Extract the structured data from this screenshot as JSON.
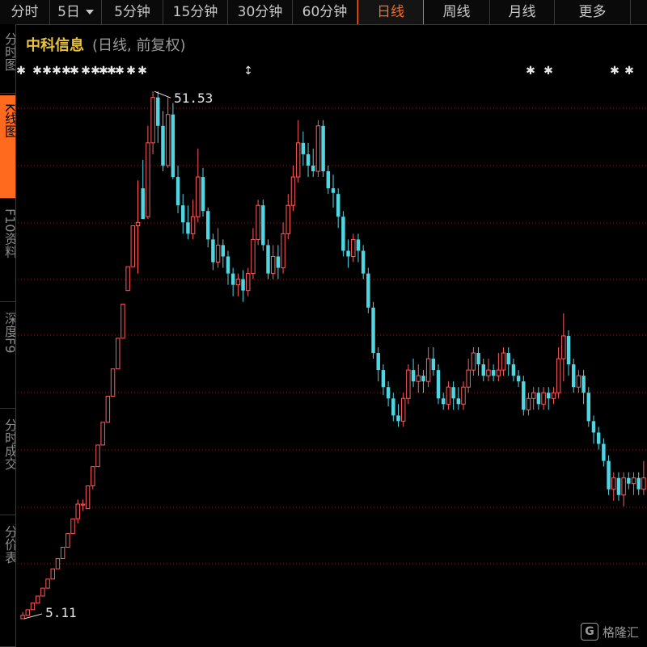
{
  "tabs": [
    {
      "label": "分时",
      "active": false
    },
    {
      "label": "5日",
      "active": false,
      "dropdown": true
    },
    {
      "label": "5分钟",
      "active": false
    },
    {
      "label": "15分钟",
      "active": false
    },
    {
      "label": "30分钟",
      "active": false
    },
    {
      "label": "60分钟",
      "active": false
    },
    {
      "label": "日线",
      "active": true
    },
    {
      "label": "周线",
      "active": false
    },
    {
      "label": "月线",
      "active": false
    },
    {
      "label": "更多",
      "active": false
    }
  ],
  "sidebar": [
    {
      "label": "分时图",
      "active": false
    },
    {
      "label": "K线图",
      "active": true
    },
    {
      "label": "F10资料",
      "active": false
    },
    {
      "label": "深度F9",
      "active": false
    },
    {
      "label": "分时成交",
      "active": false
    },
    {
      "label": "分价表",
      "active": false
    }
  ],
  "chart_title": {
    "name": "中科信息",
    "period": "(日线, 前复权)"
  },
  "watermark": {
    "logo": "G",
    "text": "格隆汇"
  },
  "colors": {
    "up": "#ff5c5c",
    "down": "#4fd6e3",
    "title": "#e8c23a",
    "active": "#ff6a1e",
    "grid": "#8a1e1e"
  },
  "chart_data": {
    "type": "candlestick",
    "price_range": [
      3.4,
      54.6
    ],
    "high_label": "51.53",
    "low_label": "5.11",
    "markers": [
      "✱",
      "✱",
      "✱",
      "✱",
      "✱",
      "✱",
      "✱",
      "✱",
      "✱",
      "✱",
      "✱",
      "✱",
      "✱",
      "↕",
      "✱",
      "✱",
      "✱",
      "✱"
    ],
    "candles": [
      [
        5.11,
        5.4,
        5.11,
        5.7
      ],
      [
        5.4,
        5.9,
        5.4,
        5.9
      ],
      [
        5.9,
        6.5,
        5.9,
        6.5
      ],
      [
        6.5,
        7.1,
        6.5,
        7.1
      ],
      [
        7.1,
        7.8,
        7.1,
        7.8
      ],
      [
        7.8,
        8.6,
        7.8,
        8.6
      ],
      [
        8.6,
        9.5,
        8.6,
        9.5
      ],
      [
        9.5,
        10.4,
        9.5,
        10.4
      ],
      [
        10.4,
        11.4,
        10.4,
        11.4
      ],
      [
        11.4,
        12.6,
        11.4,
        12.6
      ],
      [
        12.6,
        13.9,
        12.6,
        13.9
      ],
      [
        13.9,
        15.2,
        13.5,
        15.6
      ],
      [
        15.2,
        15.2,
        14.6,
        15.6
      ],
      [
        14.8,
        16.8,
        14.8,
        16.8
      ],
      [
        16.8,
        18.5,
        16.5,
        18.5
      ],
      [
        18.5,
        20.4,
        18.5,
        20.4
      ],
      [
        20.4,
        22.4,
        20.4,
        22.4
      ],
      [
        22.4,
        24.7,
        22.4,
        24.7
      ],
      [
        24.7,
        27.1,
        24.7,
        27.1
      ],
      [
        27.1,
        29.8,
        27.1,
        29.8
      ],
      [
        29.8,
        32.8,
        29.8,
        32.8
      ],
      [
        34.0,
        36.1,
        34.0,
        36.1
      ],
      [
        36.1,
        39.7,
        36.1,
        39.7
      ],
      [
        39.7,
        40.0,
        35.5,
        43.7
      ],
      [
        43.0,
        40.3,
        40.3,
        45.5
      ],
      [
        40.5,
        47.0,
        40.3,
        48.5
      ],
      [
        47.0,
        51.0,
        46.0,
        51.53
      ],
      [
        51.0,
        48.5,
        47.0,
        51.53
      ],
      [
        48.5,
        45.0,
        44.5,
        49.8
      ],
      [
        45.0,
        49.5,
        44.8,
        51.0
      ],
      [
        49.5,
        44.0,
        43.8,
        50.5
      ],
      [
        44.0,
        41.5,
        40.8,
        45.0
      ],
      [
        41.5,
        40.0,
        39.0,
        42.5
      ],
      [
        40.0,
        39.0,
        38.5,
        41.5
      ],
      [
        39.0,
        40.5,
        38.5,
        42.0
      ],
      [
        40.5,
        44.0,
        40.0,
        46.5
      ],
      [
        44.0,
        41.0,
        40.5,
        44.8
      ],
      [
        41.0,
        38.5,
        37.8,
        41.3
      ],
      [
        38.5,
        36.5,
        35.8,
        39.0
      ],
      [
        36.5,
        38.0,
        36.0,
        39.5
      ],
      [
        38.0,
        37.0,
        36.0,
        38.5
      ],
      [
        37.0,
        35.5,
        34.5,
        37.5
      ],
      [
        35.5,
        34.5,
        33.5,
        36.0
      ],
      [
        34.5,
        35.0,
        33.5,
        35.5
      ],
      [
        35.0,
        34.0,
        33.0,
        35.8
      ],
      [
        34.0,
        35.5,
        33.5,
        36.0
      ],
      [
        35.5,
        38.5,
        35.0,
        39.5
      ],
      [
        38.5,
        41.5,
        38.0,
        42.0
      ],
      [
        41.5,
        38.0,
        37.5,
        42.0
      ],
      [
        38.0,
        35.5,
        35.0,
        38.5
      ],
      [
        35.5,
        37.0,
        35.0,
        38.0
      ],
      [
        37.0,
        36.0,
        35.0,
        38.0
      ],
      [
        36.0,
        39.0,
        35.5,
        40.0
      ],
      [
        39.0,
        41.5,
        38.5,
        42.5
      ],
      [
        41.5,
        44.0,
        41.0,
        45.0
      ],
      [
        44.0,
        47.0,
        43.5,
        49.0
      ],
      [
        47.0,
        46.0,
        45.0,
        48.0
      ],
      [
        46.0,
        45.0,
        44.0,
        47.0
      ],
      [
        45.0,
        44.5,
        44.0,
        46.5
      ],
      [
        44.5,
        48.5,
        44.0,
        49.0
      ],
      [
        48.5,
        44.5,
        44.0,
        49.0
      ],
      [
        44.5,
        43.0,
        42.5,
        45.0
      ],
      [
        43.0,
        42.6,
        41.3,
        44.2
      ],
      [
        42.5,
        40.5,
        39.5,
        43.0
      ],
      [
        40.5,
        37.5,
        37.0,
        41.0
      ],
      [
        37.5,
        37.0,
        36.0,
        38.5
      ],
      [
        37.0,
        38.5,
        36.5,
        39.0
      ],
      [
        38.5,
        37.5,
        36.5,
        39.0
      ],
      [
        37.5,
        35.5,
        35.0,
        38.0
      ],
      [
        35.5,
        32.5,
        32.0,
        36.0
      ],
      [
        32.5,
        28.5,
        28.0,
        33.0
      ],
      [
        28.5,
        27.0,
        26.0,
        29.0
      ],
      [
        27.0,
        25.5,
        24.8,
        27.5
      ],
      [
        25.5,
        24.5,
        23.8,
        26.0
      ],
      [
        24.5,
        23.0,
        22.5,
        25.0
      ],
      [
        23.0,
        22.5,
        22.0,
        24.0
      ],
      [
        22.5,
        24.5,
        22.0,
        25.0
      ],
      [
        24.5,
        27.0,
        24.0,
        27.5
      ],
      [
        27.0,
        26.0,
        25.5,
        28.0
      ],
      [
        26.0,
        26.5,
        25.0,
        27.5
      ],
      [
        26.5,
        26.0,
        25.0,
        27.0
      ],
      [
        26.0,
        28.0,
        25.5,
        29.0
      ],
      [
        28.0,
        27.0,
        26.5,
        29.0
      ],
      [
        27.0,
        24.5,
        24.0,
        27.5
      ],
      [
        24.5,
        24.0,
        23.5,
        25.0
      ],
      [
        24.0,
        25.5,
        23.5,
        26.0
      ],
      [
        25.5,
        24.5,
        23.5,
        26.0
      ],
      [
        24.5,
        24.0,
        23.5,
        25.5
      ],
      [
        24.0,
        25.5,
        23.5,
        26.0
      ],
      [
        25.5,
        27.0,
        25.0,
        28.0
      ],
      [
        27.0,
        28.5,
        26.5,
        29.0
      ],
      [
        28.5,
        27.5,
        26.5,
        29.0
      ],
      [
        27.5,
        26.5,
        26.0,
        28.0
      ],
      [
        26.5,
        27.0,
        26.0,
        28.0
      ],
      [
        27.0,
        26.5,
        26.0,
        27.5
      ],
      [
        26.5,
        27.0,
        26.0,
        28.5
      ],
      [
        27.0,
        28.5,
        26.5,
        29.0
      ],
      [
        28.5,
        27.5,
        26.5,
        29.0
      ],
      [
        27.5,
        26.5,
        26.0,
        28.0
      ],
      [
        26.5,
        26.0,
        25.5,
        27.0
      ],
      [
        26.0,
        23.5,
        23.0,
        26.5
      ],
      [
        23.5,
        24.5,
        23.0,
        25.0
      ],
      [
        24.5,
        25.0,
        23.5,
        25.5
      ],
      [
        25.0,
        24.0,
        23.5,
        25.5
      ],
      [
        24.0,
        25.0,
        23.5,
        25.5
      ],
      [
        25.0,
        24.5,
        23.5,
        25.5
      ],
      [
        24.5,
        25.0,
        24.0,
        25.5
      ],
      [
        25.0,
        28.0,
        24.5,
        29.0
      ],
      [
        28.0,
        30.0,
        26.0,
        32.0
      ],
      [
        30.0,
        27.5,
        26.5,
        30.5
      ],
      [
        27.5,
        25.5,
        25.0,
        28.0
      ],
      [
        25.5,
        26.5,
        25.0,
        27.0
      ],
      [
        26.5,
        25.0,
        24.0,
        27.0
      ],
      [
        25.0,
        22.5,
        22.0,
        25.5
      ],
      [
        22.5,
        21.5,
        20.5,
        23.0
      ],
      [
        21.5,
        20.5,
        20.0,
        22.0
      ],
      [
        20.5,
        19.0,
        18.5,
        21.0
      ],
      [
        19.0,
        16.5,
        16.0,
        19.5
      ],
      [
        16.5,
        17.5,
        15.5,
        18.0
      ],
      [
        17.5,
        16.0,
        15.5,
        18.0
      ],
      [
        16.0,
        17.5,
        15.0,
        18.0
      ],
      [
        17.5,
        17.0,
        16.5,
        18.0
      ],
      [
        17.0,
        17.5,
        16.0,
        18.0
      ],
      [
        17.5,
        16.5,
        16.0,
        18.0
      ],
      [
        16.5,
        17.5,
        16.0,
        19.0
      ]
    ]
  }
}
